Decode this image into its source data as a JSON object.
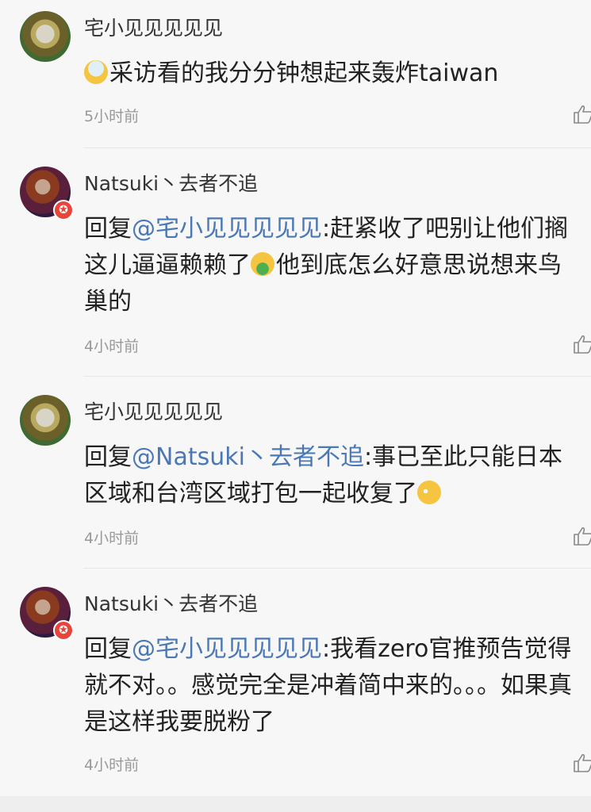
{
  "comments": [
    {
      "username": "宅小见见见见见",
      "emoji_before": "sick-face",
      "text_after_emoji": "采访看的我分分钟想起来轰炸taiwan",
      "timestamp": "5小时前",
      "avatar": "star-avatar"
    },
    {
      "username": "Natsuki丶去者不追",
      "reply_prefix": "回复",
      "mention": "@宅小见见见见见",
      "text_part1": ":赶紧收了吧别让他们搁这儿逼逼赖赖了",
      "emoji_mid": "vomiting-face",
      "text_part2": "他到底怎么好意思说想来鸟巢的",
      "timestamp": "4小时前",
      "avatar": "natsuki-avatar"
    },
    {
      "username": "宅小见见见见见",
      "reply_prefix": "回复",
      "mention": "@Natsuki丶去者不追",
      "text_part1": ":事已至此只能日本区域和台湾区域打包一起收复了",
      "emoji_end": "pleading-face",
      "timestamp": "4小时前",
      "avatar": "star-avatar"
    },
    {
      "username": "Natsuki丶去者不追",
      "reply_prefix": "回复",
      "mention": "@宅小见见见见见",
      "text_part1": ":我看zero官推预告觉得就不对。。感觉完全是冲着简中来的。。。如果真是这样我要脱粉了",
      "timestamp": "4小时前",
      "avatar": "natsuki-avatar"
    }
  ],
  "badge_glyph": "✪",
  "colors": {
    "mention": "#4a78b5",
    "timestamp": "#999999",
    "badge": "#e8443a",
    "background": "#f7f7f7"
  }
}
